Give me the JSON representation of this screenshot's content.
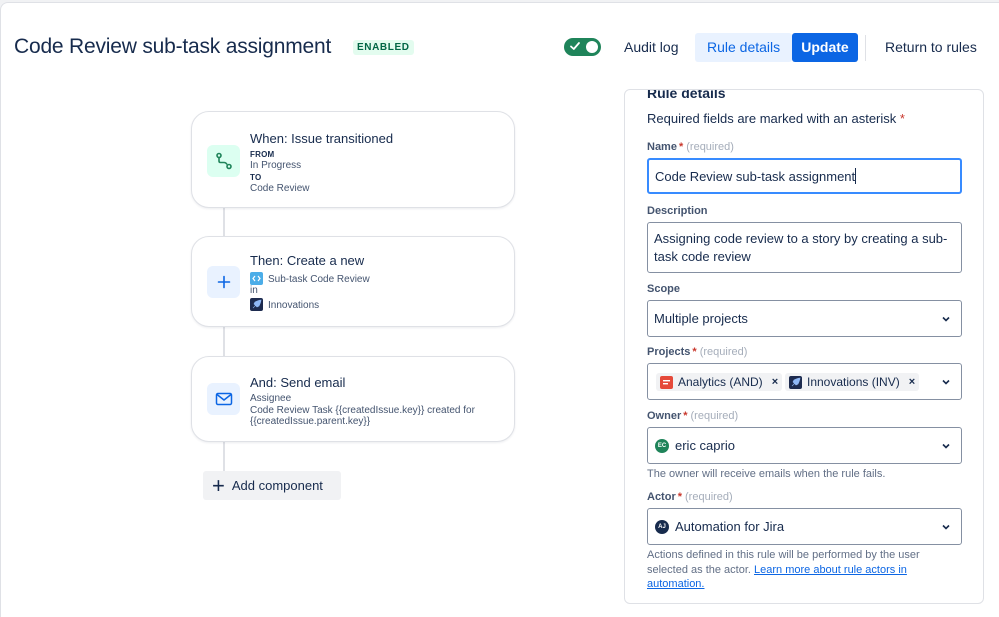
{
  "header": {
    "title": "Code Review sub-task assignment",
    "status_badge": "ENABLED",
    "toggle_on": true,
    "audit_log_label": "Audit log",
    "rule_details_label": "Rule details",
    "update_label": "Update",
    "return_label": "Return to rules"
  },
  "canvas": {
    "trigger": {
      "title": "When: Issue transitioned",
      "from_label": "FROM",
      "from_value": "In Progress",
      "to_label": "TO",
      "to_value": "Code Review",
      "icon": "transition-icon"
    },
    "action": {
      "title": "Then: Create a new",
      "issue_type": "Sub-task Code Review",
      "in_label": "in",
      "project": "Innovations",
      "icon": "plus-icon"
    },
    "email": {
      "title": "And: Send email",
      "recipient": "Assignee",
      "subject_line1": "Code Review Task {{createdIssue.key}} created for",
      "subject_line2": "{{createdIssue.parent.key}}",
      "icon": "mail-icon"
    },
    "add_component_label": "Add component"
  },
  "panel": {
    "heading": "Rule details",
    "required_note": "Required fields are marked with an asterisk",
    "asterisk": "*",
    "required_hint": "(required)",
    "name": {
      "label": "Name",
      "value": "Code Review sub-task assignment"
    },
    "description": {
      "label": "Description",
      "line1": "Assigning code review to a story by creating a sub-",
      "line2": "task code review"
    },
    "scope": {
      "label": "Scope",
      "value": "Multiple projects"
    },
    "projects": {
      "label": "Projects",
      "chips": [
        "Analytics (AND)",
        "Innovations (INV)"
      ],
      "remove_glyph": "×"
    },
    "owner": {
      "label": "Owner",
      "value": "eric caprio",
      "avatar_initials": "EC",
      "helper": "The owner will receive emails when the rule fails."
    },
    "actor": {
      "label": "Actor",
      "value": "Automation for Jira",
      "avatar_initials": "AJ",
      "helper_line1": "Actions defined in this rule will be performed by the user",
      "helper_line2_prefix": "selected as the actor. ",
      "helper_link_part1": "Learn more about rule actors in",
      "helper_link_part2": "automation."
    }
  },
  "colors": {
    "primary": "#0c66e4",
    "toggle_on": "#1f845a",
    "enabled_bg": "#e3fcef",
    "enabled_text": "#006644",
    "required_red": "#c9372c"
  }
}
